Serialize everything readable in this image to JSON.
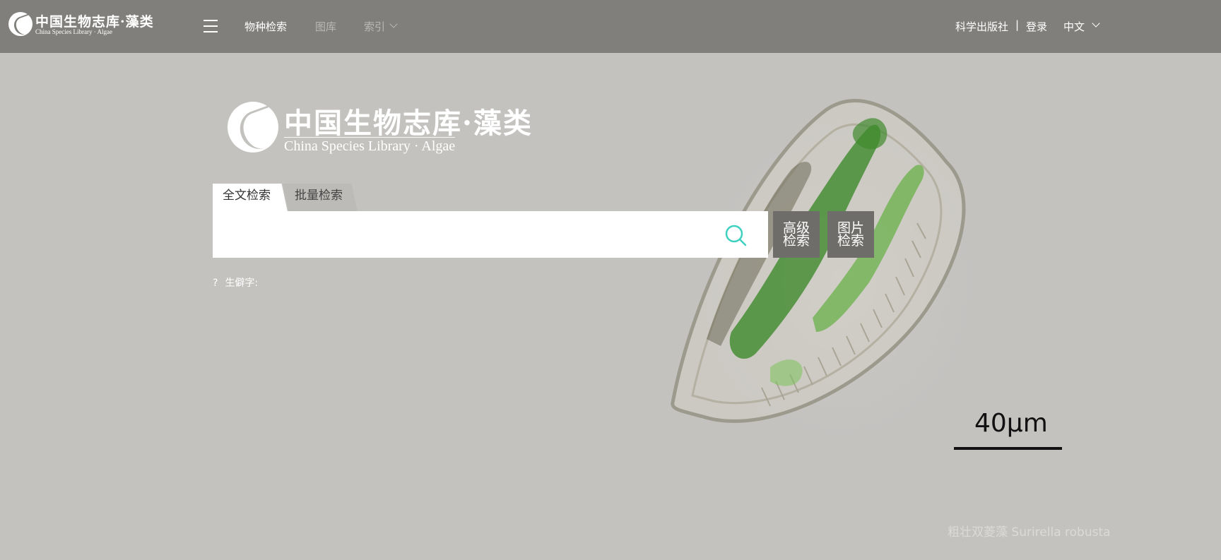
{
  "header": {
    "logo": {
      "cn": "中国生物志库·藻类",
      "en": "China Species Library · Algae"
    },
    "nav": [
      {
        "label": "物种检索",
        "active": true
      },
      {
        "label": "图库",
        "active": false
      },
      {
        "label": "索引",
        "active": false,
        "has_dropdown": true
      }
    ],
    "publisher": "科学出版社",
    "separator": "|",
    "login": "登录",
    "language": "中文"
  },
  "hero": {
    "logo": {
      "cn": "中国生物志库·藻类",
      "en": "China Species Library · Algae"
    }
  },
  "search": {
    "tabs": [
      {
        "label": "全文检索",
        "active": true
      },
      {
        "label": "批量检索",
        "active": false
      }
    ],
    "value": "",
    "placeholder": "",
    "advanced_btn": {
      "line1": "高级",
      "line2": "检索"
    },
    "image_btn": {
      "line1": "图片",
      "line2": "检索"
    },
    "help_mark": "?",
    "help_label": "生僻字:"
  },
  "image_info": {
    "scale_label": "40μm",
    "caption": "粗壮双菱藻 Surirella robusta"
  },
  "colors": {
    "header_bg": "#807f7c",
    "page_bg": "#c4c2bf",
    "search_icon": "#3fd1c0",
    "side_button_bg": "#6f6d6a"
  },
  "icons": [
    "menu-icon",
    "search-icon",
    "chevron-down-icon"
  ]
}
